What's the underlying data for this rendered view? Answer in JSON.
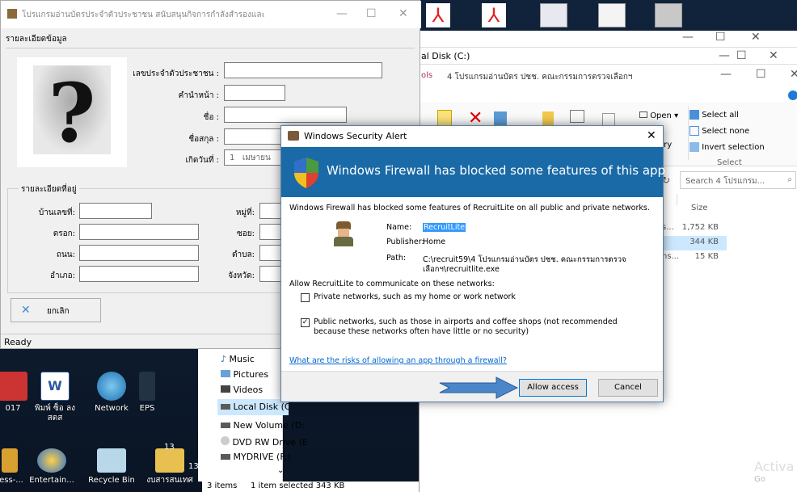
{
  "thai_app": {
    "title": "โปรแกรมอ่านบัตรประจำตัวประชาชน สนับสนุนกิจการกำลังสำรองและการสัสดี",
    "section_person": "รายละเอียดข้อมูล",
    "labels": {
      "id_card": "เลขประจำตัวประชาชน :",
      "prefix": "คำนำหน้า :",
      "first_name": "ชื่อ :",
      "last_name": "ชื่อสกุล :",
      "birth_date": "เกิดวันที่ :"
    },
    "birth_day": "1",
    "birth_month": "เมษายน",
    "address_section": "รายละเอียดที่อยู่",
    "address_labels": {
      "house_no": "บ้านเลขที่:",
      "moo": "หมู่ที่:",
      "alley": "ตรอก:",
      "soi": "ซอย:",
      "road": "ถนน:",
      "tambon": "ตำบล:",
      "amphoe": "อำเภอ:",
      "province": "จังหวัด:"
    },
    "cancel_label": "ยกเลิก",
    "status": "Ready"
  },
  "explorer": {
    "address_fragment": "al Disk (C:)",
    "subwindow_tab_fragment": "ols",
    "subwindow_title": "4 โปรแกรมอ่านบัตร ปชช. คณะกรรมการตรวจเลือกฯ",
    "ribbon": {
      "open": "Open",
      "select_all": "Select all",
      "select_none": "Select none",
      "invert_selection": "Invert selection",
      "group_select": "Select",
      "ory_fragment": "ory"
    },
    "search_placeholder": "Search 4 โปรแกรม...",
    "column_size": "Size",
    "rows": [
      {
        "name_fragment": "s...",
        "size": "1,752 KB",
        "selected": false
      },
      {
        "name_fragment": "",
        "size": "344 KB",
        "selected": true
      },
      {
        "name_fragment": "ns...",
        "size": "15 KB",
        "selected": false
      }
    ],
    "nav_items": [
      "Music",
      "Pictures",
      "Videos",
      "Local Disk (C:)",
      "New Volume (D:",
      "DVD RW Drive (E",
      "MYDRIVE (F:)"
    ],
    "status_items": "3 items",
    "status_selected": "1 item selected  343 KB"
  },
  "desktop": {
    "icons": [
      "017",
      "พิมพ์ ซ็อ ลง สตส",
      "Network",
      "EPS",
      "ress-...",
      "Entertain...",
      "Recycle Bin",
      "งบสารสนเทศ"
    ],
    "numbers": [
      "13",
      "13"
    ],
    "activate": "Activa",
    "activate_sub": "Go"
  },
  "dialog": {
    "title": "Windows Security Alert",
    "banner": "Windows Firewall has blocked some features of this app",
    "intro": "Windows Firewall has blocked some features of RecruitLite on all public and private networks.",
    "name_label": "Name:",
    "name_value": "RecruitLite",
    "publisher_label": "Publisher:",
    "publisher_value": "Home",
    "path_label": "Path:",
    "path_value_1": "C:\\recruit59\\4 โปรแกรมอ่านบัตร ปชช. คณะกรรมการตรวจ",
    "path_value_2": "เลือกฯ\\recruitlite.exe",
    "allow_prompt": "Allow RecruitLite to communicate on these networks:",
    "private_label": "Private networks, such as my home or work network",
    "private_checked": false,
    "public_label_1": "Public networks, such as those in airports and coffee shops (not recommended",
    "public_label_2": "because these networks often have little or no security)",
    "public_checked": true,
    "risk_link": "What are the risks of allowing an app through a firewall?",
    "allow_button": "Allow access",
    "cancel_button": "Cancel"
  },
  "colors": {
    "banner": "#1a6aa7",
    "link": "#0066cc",
    "selection": "#cce8ff",
    "arrow": "#4a86c8"
  }
}
